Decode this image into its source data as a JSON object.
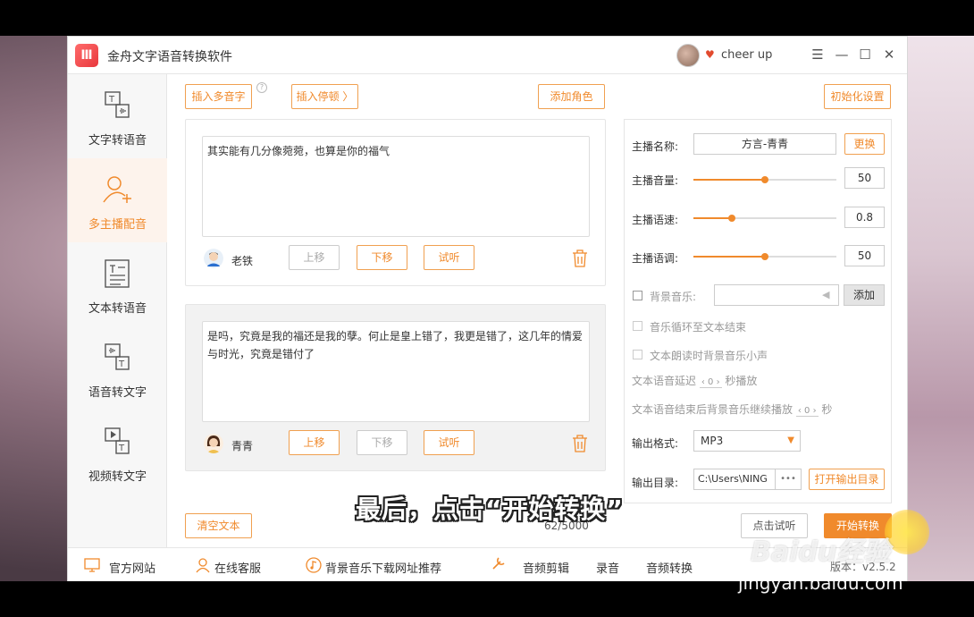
{
  "app": {
    "title": "金舟文字语音转换软件",
    "logo_glyph": "Ⅲ",
    "username": "cheer up",
    "window_controls": {
      "menu": "☰",
      "minimize": "—",
      "maximize": "☐",
      "close": "✕"
    }
  },
  "sidebar": {
    "items": [
      {
        "label": "文字转语音",
        "icon": "text-to-speech-icon",
        "active": false
      },
      {
        "label": "多主播配音",
        "icon": "user-add-icon",
        "active": true
      },
      {
        "label": "文本转语音",
        "icon": "document-icon",
        "active": false
      },
      {
        "label": "语音转文字",
        "icon": "speech-to-text-icon",
        "active": false
      },
      {
        "label": "视频转文字",
        "icon": "video-to-text-icon",
        "active": false
      }
    ]
  },
  "toolbar": {
    "insert_polyphone": "插入多音字",
    "insert_pause": "插入停顿 〉",
    "add_role": "添加角色",
    "reset_settings": "初始化设置",
    "help_glyph": "?"
  },
  "dialogues": [
    {
      "text": "其实能有几分像菀菀，也算是你的福气",
      "role_name": "老铁",
      "move_up": "上移",
      "move_down": "下移",
      "preview": "试听"
    },
    {
      "text": "是吗，究竟是我的福还是我的孽。何止是皇上错了，我更是错了，这几年的情爱与时光，究竟是错付了",
      "role_name": "青青",
      "move_up": "上移",
      "move_down": "下移",
      "preview": "试听"
    }
  ],
  "bottom": {
    "clear_text": "清空文本",
    "char_count": "62/5000",
    "preview_click": "点击试听",
    "start_convert": "开始转换"
  },
  "settings": {
    "anchor_label": "主播名称:",
    "anchor_value": "方言-青青",
    "change": "更换",
    "volume_label": "主播音量:",
    "volume_value": "50",
    "volume_level": 0.5,
    "speed_label": "主播语速:",
    "speed_value": "0.8",
    "speed_level": 0.27,
    "pitch_label": "主播语调:",
    "pitch_value": "50",
    "pitch_level": 0.5,
    "bg_music_label": "背景音乐:",
    "bg_music_add": "添加",
    "loop_label": "音乐循环至文本结束",
    "duck_label": "文本朗读时背景音乐小声",
    "delay_prefix": "文本语音延迟",
    "delay_value": "0",
    "delay_suffix": "秒播放",
    "continue_prefix": "文本语音结束后背景音乐继续播放",
    "continue_value": "0",
    "continue_suffix": "秒",
    "format_label": "输出格式:",
    "format_value": "MP3",
    "dir_label": "输出目录:",
    "dir_value": "C:\\Users\\NING",
    "dir_more": "•••",
    "open_dir": "打开输出目录"
  },
  "footer": {
    "website": "官方网站",
    "support": "在线客服",
    "music_rec": "背景音乐下载网址推荐",
    "audio_cut": "音频剪辑",
    "record": "录音",
    "audio_convert": "音频转换",
    "version": "版本：v2.5.2"
  },
  "overlay": {
    "subtitle": "最后，点击“开始转换”",
    "watermark": "jingyan.baidu.com",
    "baidu_logo": "Baidu经验"
  },
  "colors": {
    "accent": "#f08a2c",
    "vip": "#e24a2e"
  }
}
